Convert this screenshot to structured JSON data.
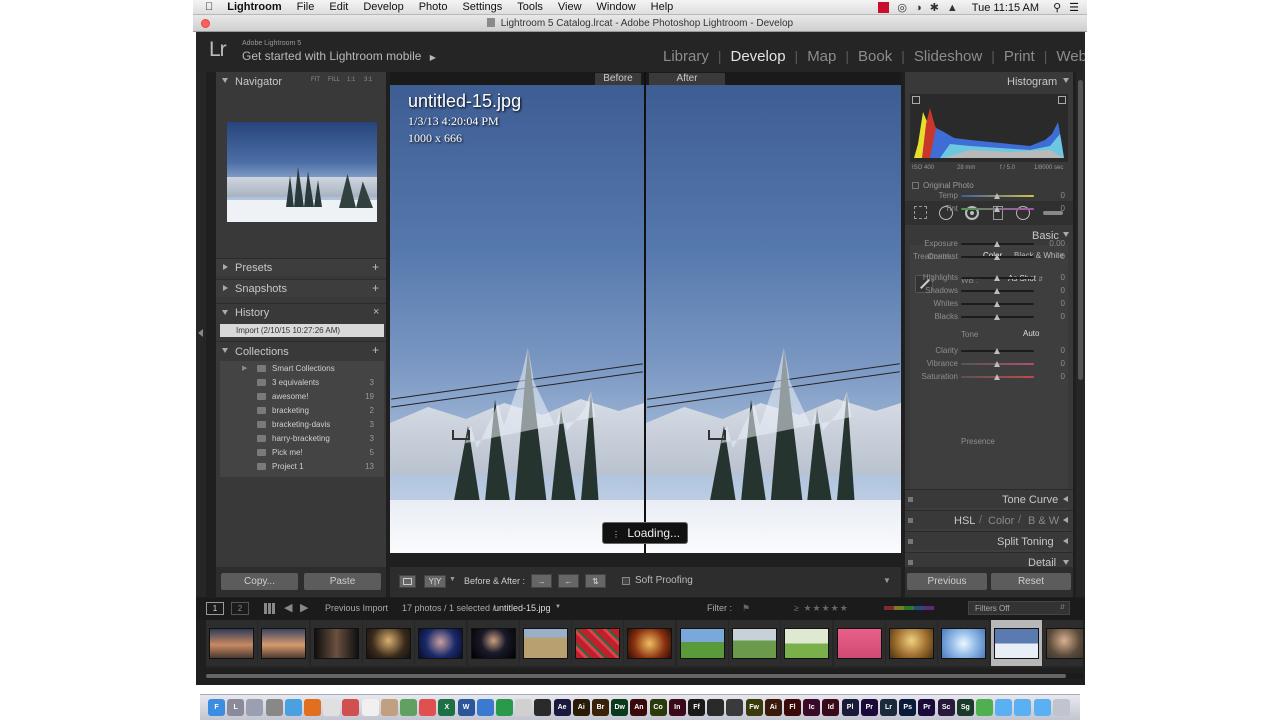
{
  "menubar": {
    "apple_icon": "apple-icon",
    "app_name": "Lightroom",
    "items": [
      "File",
      "Edit",
      "Develop",
      "Photo",
      "Settings",
      "Tools",
      "View",
      "Window",
      "Help"
    ],
    "clock": "Tue 11:15 AM"
  },
  "window": {
    "title": "Lightroom 5 Catalog.lrcat - Adobe Photoshop Lightroom - Develop"
  },
  "identity": {
    "logo": "Lr",
    "product": "Adobe Lightroom 5",
    "mobile_prompt": "Get started with Lightroom mobile",
    "modules": [
      "Library",
      "Develop",
      "Map",
      "Book",
      "Slideshow",
      "Print",
      "Web"
    ],
    "active_module": "Develop"
  },
  "left_panel": {
    "navigator": {
      "title": "Navigator",
      "zoom_options": [
        "FIT",
        "FILL",
        "1:1",
        "3:1"
      ]
    },
    "presets": {
      "title": "Presets"
    },
    "snapshots": {
      "title": "Snapshots"
    },
    "history": {
      "title": "History",
      "items": [
        "Import (2/10/15 10:27:26 AM)"
      ]
    },
    "collections": {
      "title": "Collections",
      "items": [
        {
          "name": "Smart Collections",
          "count": ""
        },
        {
          "name": "3 equivalents",
          "count": "3"
        },
        {
          "name": "awesome!",
          "count": "19"
        },
        {
          "name": "bracketing",
          "count": "2"
        },
        {
          "name": "bracketing-davis",
          "count": "3"
        },
        {
          "name": "harry-bracketing",
          "count": "3"
        },
        {
          "name": "Pick me!",
          "count": "5"
        },
        {
          "name": "Project 1",
          "count": "13"
        }
      ]
    },
    "copy_label": "Copy...",
    "paste_label": "Paste"
  },
  "center": {
    "before_label": "Before",
    "after_label": "After",
    "file_name": "untitled-15.jpg",
    "date": "1/3/13 4:20:04 PM",
    "dimensions": "1000 x 666",
    "loading": "Loading...",
    "toolbar": {
      "before_after_label": "Before & After :",
      "soft_proofing": "Soft Proofing"
    }
  },
  "right_panel": {
    "histogram": {
      "title": "Histogram",
      "iso": "ISO 400",
      "focal": "28 mm",
      "aperture": "f / 5.0",
      "shutter": "1/8000 sec",
      "original_photo": "Original Photo"
    },
    "basic": {
      "title": "Basic",
      "treatment_label": "Treatment :",
      "color": "Color",
      "bw": "Black & White",
      "wb_label": "WB :",
      "wb_value": "As Shot",
      "tone_label": "Tone",
      "auto_label": "Auto",
      "presence_label": "Presence",
      "sliders": [
        {
          "name": "Temp",
          "value": "0",
          "group": "wb"
        },
        {
          "name": "Tint",
          "value": "0",
          "group": "wb"
        },
        {
          "name": "Exposure",
          "value": "0.00",
          "group": "tone"
        },
        {
          "name": "Contrast",
          "value": "0",
          "group": "tone"
        },
        {
          "name": "Highlights",
          "value": "0",
          "group": "tone2"
        },
        {
          "name": "Shadows",
          "value": "0",
          "group": "tone2"
        },
        {
          "name": "Whites",
          "value": "0",
          "group": "tone2"
        },
        {
          "name": "Blacks",
          "value": "0",
          "group": "tone2"
        },
        {
          "name": "Clarity",
          "value": "0",
          "group": "presence"
        },
        {
          "name": "Vibrance",
          "value": "0",
          "group": "presence"
        },
        {
          "name": "Saturation",
          "value": "0",
          "group": "presence"
        }
      ]
    },
    "tone_curve": "Tone Curve",
    "hsl": "HSL",
    "hsl_color": "Color",
    "hsl_bw": "B & W",
    "split_toning": "Split Toning",
    "detail": "Detail",
    "previous_label": "Previous",
    "reset_label": "Reset"
  },
  "filmstrip": {
    "page1": "1",
    "page2": "2",
    "source": "Previous Import",
    "count": "17 photos / 1 selected /",
    "selected_file": "untitled-15.jpg",
    "filter_label": "Filter :",
    "filters_off": "Filters Off",
    "thumbnails": [
      "sunset-beach",
      "sunset-beach-2",
      "portrait-dark",
      "portrait-blonde",
      "portrait-blue",
      "portrait-suit",
      "building",
      "red-flowers",
      "interior-warm",
      "green-field",
      "green-hills",
      "green-meadow",
      "pink-card",
      "golden-room",
      "blue-sky-ball",
      "snowy-trees",
      "portrait-woman"
    ]
  },
  "colors": {
    "accent": "#e6e6e6",
    "panel": "#393939",
    "background": "#1f1f1f"
  }
}
